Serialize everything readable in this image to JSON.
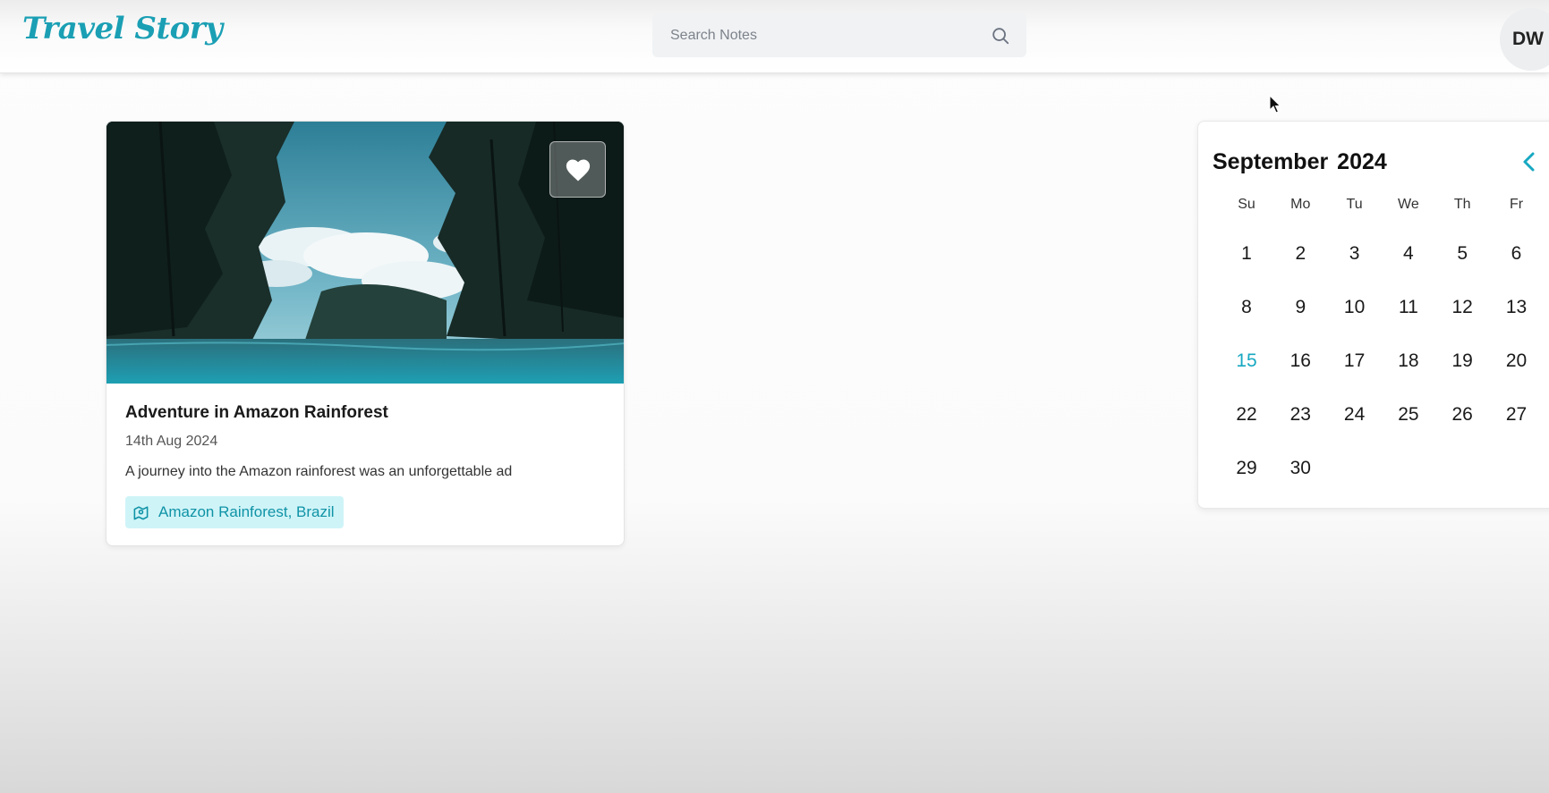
{
  "navbar": {
    "logo": "Travel Story",
    "search_placeholder": "Search Notes",
    "avatar_initials": "DW"
  },
  "story_card": {
    "title": "Adventure in Amazon Rainforest",
    "date": "14th Aug 2024",
    "description": "A journey into the Amazon rainforest was an unforgettable ad",
    "location": "Amazon Rainforest, Brazil",
    "favorite_icon": "heart-icon",
    "location_icon": "map-icon"
  },
  "calendar": {
    "month": "September",
    "year": "2024",
    "weekdays": [
      "Su",
      "Mo",
      "Tu",
      "We",
      "Th",
      "Fr"
    ],
    "days": [
      [
        "1",
        "2",
        "3",
        "4",
        "5",
        "6"
      ],
      [
        "8",
        "9",
        "10",
        "11",
        "12",
        "13"
      ],
      [
        "15",
        "16",
        "17",
        "18",
        "19",
        "20"
      ],
      [
        "22",
        "23",
        "24",
        "25",
        "26",
        "27"
      ],
      [
        "29",
        "30"
      ]
    ],
    "today": "15",
    "nav_icon": "chevron-left-icon"
  },
  "colors": {
    "accent": "#17a8c2",
    "chip_bg": "#cff4f8"
  }
}
